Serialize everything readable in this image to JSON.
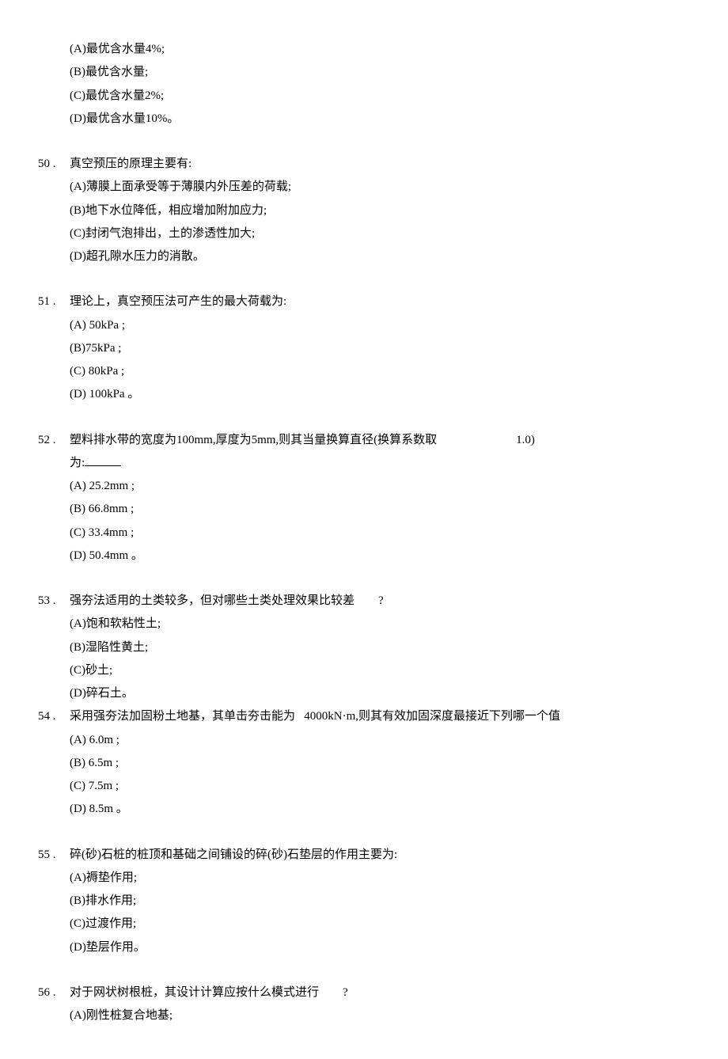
{
  "q49": {
    "opts": [
      "(A)最优含水量4%;",
      "(B)最优含水量;",
      "(C)最优含水量2%;",
      "(D)最优含水量10%。"
    ]
  },
  "q50": {
    "num": "50 .",
    "stem": "真空预压的原理主要有:",
    "opts": [
      "(A)薄膜上面承受等于薄膜内外压差的荷载;",
      "(B)地下水位降低，相应增加附加应力;",
      "(C)封闭气泡排出，土的渗透性加大;",
      "(D)超孔隙水压力的消散。"
    ]
  },
  "q51": {
    "num": "51 .",
    "stem": "理论上，真空预压法可产生的最大荷载为:",
    "opts": [
      "(A)  50kPa ;",
      "(B)75kPa ;",
      "(C)  80kPa ;",
      "(D)  100kPa 。"
    ]
  },
  "q52": {
    "num": "52 .",
    "stem1": "塑料排水带的宽度为100mm,厚度为5mm,则其当量换算直径(换算系数取",
    "stem1_tail": "1.0)",
    "stem2_prefix": "为:",
    "opts": [
      "(A)  25.2mm ;",
      "(B)  66.8mm ;",
      "(C)  33.4mm ;",
      "(D)  50.4mm 。"
    ]
  },
  "q53": {
    "num": "53 .",
    "stem": "强夯法适用的土类较多，但对哪些土类处理效果比较差",
    "stem_tail": "?",
    "opts": [
      "(A)饱和软粘性土;",
      "(B)湿陷性黄土;",
      "(C)砂土;",
      "(D)碎石土。"
    ]
  },
  "q54": {
    "num": "54 .",
    "stem_a": "采用强夯法加固粉土地基，其单击夯击能为",
    "stem_b": "4000kN·m,则其有效加固深度最接近下列哪一个值",
    "opts": [
      "(A)  6.0m ;",
      "(B)  6.5m ;",
      "(C)  7.5m ;",
      "(D)  8.5m 。"
    ]
  },
  "q55": {
    "num": "55 .",
    "stem": "碎(砂)石桩的桩顶和基础之间铺设的碎(砂)石垫层的作用主要为:",
    "opts": [
      "(A)褥垫作用;",
      "(B)排水作用;",
      "(C)过渡作用;",
      "(D)垫层作用。"
    ]
  },
  "q56": {
    "num": "56 .",
    "stem": "对于网状树根桩，其设计计算应按什么模式进行",
    "stem_tail": "?",
    "opts": [
      "(A)刚性桩复合地基;"
    ]
  }
}
